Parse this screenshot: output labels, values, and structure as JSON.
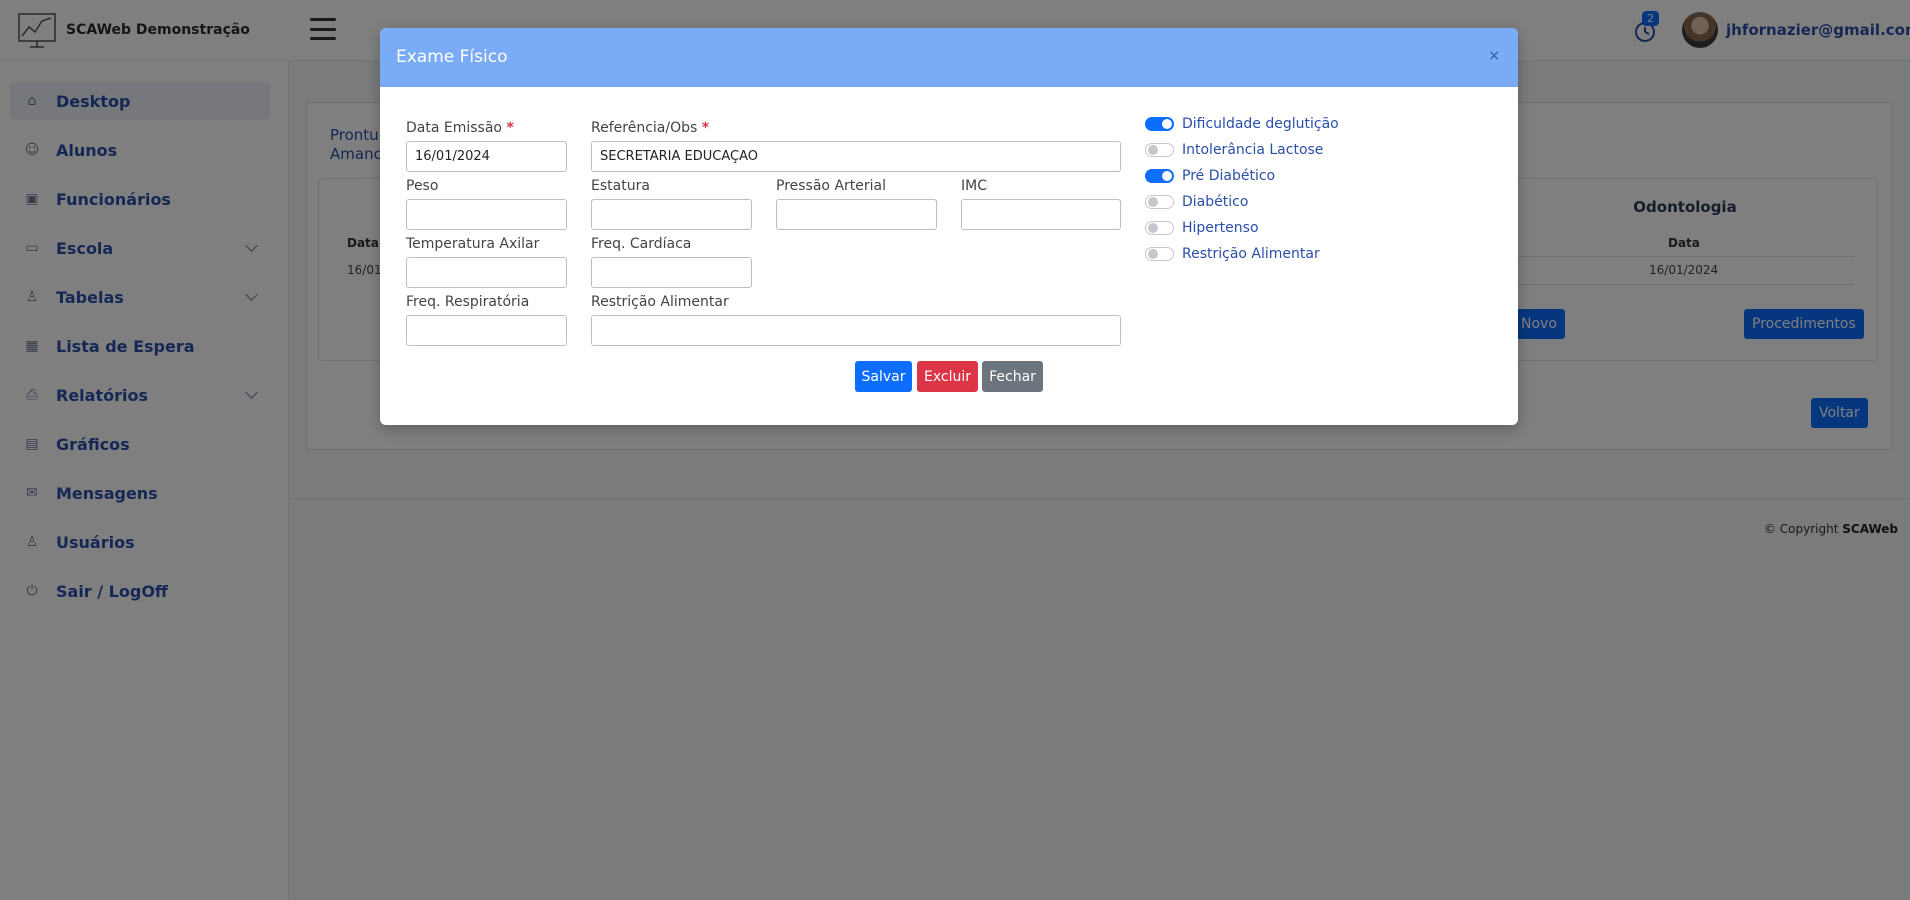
{
  "app": {
    "name": "SCAWeb Demonstração"
  },
  "header": {
    "notification_count": "2",
    "user_email": "jhfornazier@gmail.com"
  },
  "sidebar": {
    "items": [
      {
        "label": "Desktop",
        "icon": "home-icon",
        "active": true
      },
      {
        "label": "Alunos",
        "icon": "users-icon"
      },
      {
        "label": "Funcionários",
        "icon": "id-card-icon"
      },
      {
        "label": "Escola",
        "icon": "briefcase-icon",
        "has_submenu": true
      },
      {
        "label": "Tabelas",
        "icon": "user-icon",
        "has_submenu": true
      },
      {
        "label": "Lista de Espera",
        "icon": "calendar-icon"
      },
      {
        "label": "Relatórios",
        "icon": "printer-icon",
        "has_submenu": true
      },
      {
        "label": "Gráficos",
        "icon": "chart-icon"
      },
      {
        "label": "Mensagens",
        "icon": "message-icon"
      },
      {
        "label": "Usuários",
        "icon": "user-icon"
      },
      {
        "label": "Sair / LogOff",
        "icon": "power-icon"
      }
    ]
  },
  "background": {
    "prontuario_line1": "Prontu",
    "prontuario_line2": "Amanc",
    "left_table": {
      "header": "Data",
      "cell": "16/01"
    },
    "odontologia": {
      "title": "Odontologia",
      "header": "Data",
      "cell": "16/01/2024"
    },
    "buttons": {
      "novo": "Novo",
      "procedimentos": "Procedimentos",
      "voltar": "Voltar"
    },
    "copyright_prefix": "© Copyright",
    "copyright_brand": "SCAWeb"
  },
  "modal": {
    "title": "Exame Físico",
    "close": "×",
    "fields": {
      "data_emissao": {
        "label": "Data Emissão",
        "value": "16/01/2024"
      },
      "referencia": {
        "label": "Referência/Obs",
        "value": "SECRETARIA EDUCAÇÃO"
      },
      "peso": {
        "label": "Peso",
        "value": ""
      },
      "estatura": {
        "label": "Estatura",
        "value": ""
      },
      "pressao": {
        "label": "Pressão Arterial",
        "value": ""
      },
      "imc": {
        "label": "IMC",
        "value": ""
      },
      "temperatura": {
        "label": "Temperatura Axilar",
        "value": ""
      },
      "freq_cardiaca": {
        "label": "Freq. Cardíaca",
        "value": ""
      },
      "freq_respiratoria": {
        "label": "Freq. Respiratória",
        "value": ""
      },
      "restricao": {
        "label": "Restrição Alimentar",
        "value": ""
      }
    },
    "required_mark": "*",
    "toggles": [
      {
        "label": "Dificuldade deglutição",
        "checked": true
      },
      {
        "label": "Intolerância Lactose",
        "checked": false
      },
      {
        "label": "Pré Diabético",
        "checked": true
      },
      {
        "label": "Diabético",
        "checked": false
      },
      {
        "label": "Hipertenso",
        "checked": false
      },
      {
        "label": "Restrição Alimentar",
        "checked": false
      }
    ],
    "buttons": {
      "salvar": "Salvar",
      "excluir": "Excluir",
      "fechar": "Fechar"
    }
  },
  "colors": {
    "primary": "#0d6efd",
    "danger": "#dc3545",
    "secondary": "#6c757d",
    "modal_header": "#7aabf7"
  }
}
